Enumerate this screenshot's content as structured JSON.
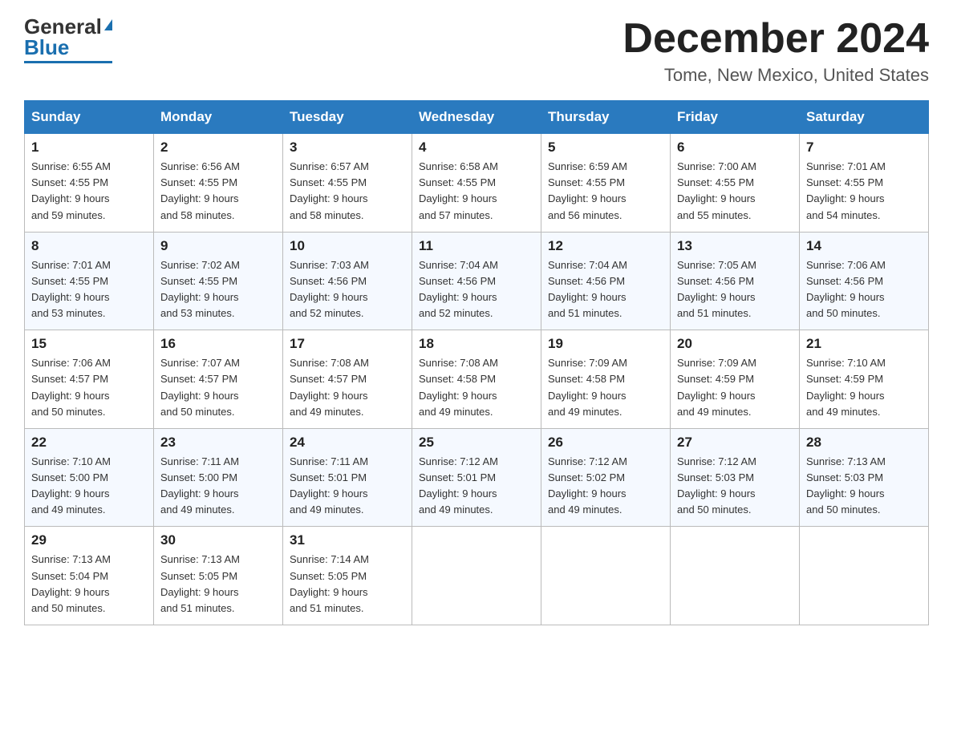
{
  "header": {
    "logo_general": "General",
    "logo_blue": "Blue",
    "month_title": "December 2024",
    "location": "Tome, New Mexico, United States"
  },
  "days_of_week": [
    "Sunday",
    "Monday",
    "Tuesday",
    "Wednesday",
    "Thursday",
    "Friday",
    "Saturday"
  ],
  "weeks": [
    [
      {
        "day": "1",
        "sunrise": "6:55 AM",
        "sunset": "4:55 PM",
        "daylight": "9 hours and 59 minutes."
      },
      {
        "day": "2",
        "sunrise": "6:56 AM",
        "sunset": "4:55 PM",
        "daylight": "9 hours and 58 minutes."
      },
      {
        "day": "3",
        "sunrise": "6:57 AM",
        "sunset": "4:55 PM",
        "daylight": "9 hours and 58 minutes."
      },
      {
        "day": "4",
        "sunrise": "6:58 AM",
        "sunset": "4:55 PM",
        "daylight": "9 hours and 57 minutes."
      },
      {
        "day": "5",
        "sunrise": "6:59 AM",
        "sunset": "4:55 PM",
        "daylight": "9 hours and 56 minutes."
      },
      {
        "day": "6",
        "sunrise": "7:00 AM",
        "sunset": "4:55 PM",
        "daylight": "9 hours and 55 minutes."
      },
      {
        "day": "7",
        "sunrise": "7:01 AM",
        "sunset": "4:55 PM",
        "daylight": "9 hours and 54 minutes."
      }
    ],
    [
      {
        "day": "8",
        "sunrise": "7:01 AM",
        "sunset": "4:55 PM",
        "daylight": "9 hours and 53 minutes."
      },
      {
        "day": "9",
        "sunrise": "7:02 AM",
        "sunset": "4:55 PM",
        "daylight": "9 hours and 53 minutes."
      },
      {
        "day": "10",
        "sunrise": "7:03 AM",
        "sunset": "4:56 PM",
        "daylight": "9 hours and 52 minutes."
      },
      {
        "day": "11",
        "sunrise": "7:04 AM",
        "sunset": "4:56 PM",
        "daylight": "9 hours and 52 minutes."
      },
      {
        "day": "12",
        "sunrise": "7:04 AM",
        "sunset": "4:56 PM",
        "daylight": "9 hours and 51 minutes."
      },
      {
        "day": "13",
        "sunrise": "7:05 AM",
        "sunset": "4:56 PM",
        "daylight": "9 hours and 51 minutes."
      },
      {
        "day": "14",
        "sunrise": "7:06 AM",
        "sunset": "4:56 PM",
        "daylight": "9 hours and 50 minutes."
      }
    ],
    [
      {
        "day": "15",
        "sunrise": "7:06 AM",
        "sunset": "4:57 PM",
        "daylight": "9 hours and 50 minutes."
      },
      {
        "day": "16",
        "sunrise": "7:07 AM",
        "sunset": "4:57 PM",
        "daylight": "9 hours and 50 minutes."
      },
      {
        "day": "17",
        "sunrise": "7:08 AM",
        "sunset": "4:57 PM",
        "daylight": "9 hours and 49 minutes."
      },
      {
        "day": "18",
        "sunrise": "7:08 AM",
        "sunset": "4:58 PM",
        "daylight": "9 hours and 49 minutes."
      },
      {
        "day": "19",
        "sunrise": "7:09 AM",
        "sunset": "4:58 PM",
        "daylight": "9 hours and 49 minutes."
      },
      {
        "day": "20",
        "sunrise": "7:09 AM",
        "sunset": "4:59 PM",
        "daylight": "9 hours and 49 minutes."
      },
      {
        "day": "21",
        "sunrise": "7:10 AM",
        "sunset": "4:59 PM",
        "daylight": "9 hours and 49 minutes."
      }
    ],
    [
      {
        "day": "22",
        "sunrise": "7:10 AM",
        "sunset": "5:00 PM",
        "daylight": "9 hours and 49 minutes."
      },
      {
        "day": "23",
        "sunrise": "7:11 AM",
        "sunset": "5:00 PM",
        "daylight": "9 hours and 49 minutes."
      },
      {
        "day": "24",
        "sunrise": "7:11 AM",
        "sunset": "5:01 PM",
        "daylight": "9 hours and 49 minutes."
      },
      {
        "day": "25",
        "sunrise": "7:12 AM",
        "sunset": "5:01 PM",
        "daylight": "9 hours and 49 minutes."
      },
      {
        "day": "26",
        "sunrise": "7:12 AM",
        "sunset": "5:02 PM",
        "daylight": "9 hours and 49 minutes."
      },
      {
        "day": "27",
        "sunrise": "7:12 AM",
        "sunset": "5:03 PM",
        "daylight": "9 hours and 50 minutes."
      },
      {
        "day": "28",
        "sunrise": "7:13 AM",
        "sunset": "5:03 PM",
        "daylight": "9 hours and 50 minutes."
      }
    ],
    [
      {
        "day": "29",
        "sunrise": "7:13 AM",
        "sunset": "5:04 PM",
        "daylight": "9 hours and 50 minutes."
      },
      {
        "day": "30",
        "sunrise": "7:13 AM",
        "sunset": "5:05 PM",
        "daylight": "9 hours and 51 minutes."
      },
      {
        "day": "31",
        "sunrise": "7:14 AM",
        "sunset": "5:05 PM",
        "daylight": "9 hours and 51 minutes."
      },
      null,
      null,
      null,
      null
    ]
  ]
}
